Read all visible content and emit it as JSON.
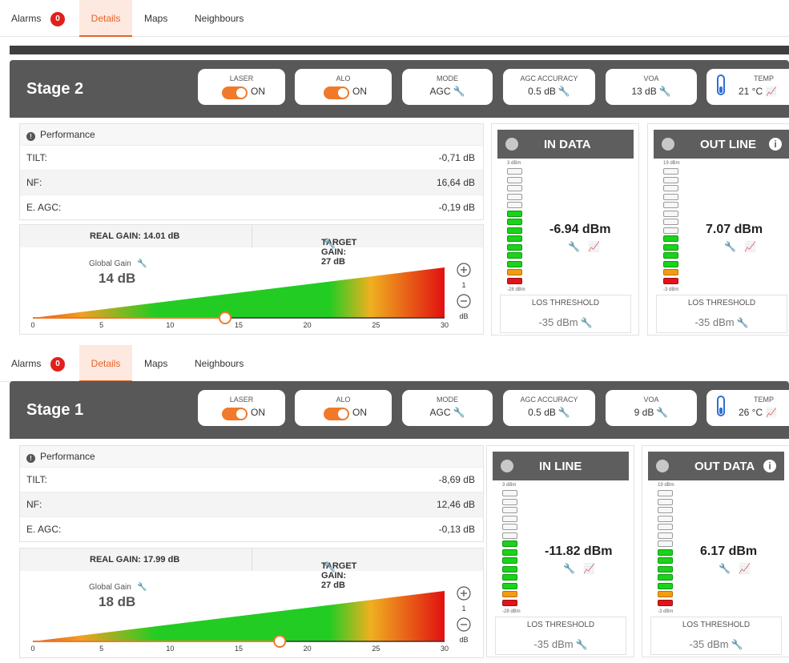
{
  "panels": [
    {
      "tabs": {
        "alarms": "Alarms",
        "alarm_count": "0",
        "details": "Details",
        "maps": "Maps",
        "neighbours": "Neighbours"
      },
      "title": "Stage 2",
      "laser": {
        "label": "LASER",
        "value": "ON"
      },
      "alo": {
        "label": "ALO",
        "value": "ON"
      },
      "mode": {
        "label": "MODE",
        "value": "AGC"
      },
      "agc_accuracy": {
        "label": "AGC ACCURACY",
        "value": "0.5 dB"
      },
      "voa": {
        "label": "VOA",
        "value": "13 dB"
      },
      "temp": {
        "label": "TEMP",
        "value": "21 °C"
      },
      "performance": {
        "title": "Performance",
        "rows": [
          {
            "label": "TILT:",
            "value": "-0,71 dB"
          },
          {
            "label": "NF:",
            "value": "16,64 dB"
          },
          {
            "label": "E. AGC:",
            "value": "-0,19 dB"
          }
        ]
      },
      "gain": {
        "real": "REAL GAIN: 14.01 dB",
        "target": "TARGET GAIN: 27 dB",
        "global_label": "Global Gain",
        "global_value": "14 dB",
        "slider_value": 14.01,
        "scale_max": 30,
        "ticks": [
          "0",
          "5",
          "10",
          "15",
          "20",
          "25",
          "30"
        ],
        "step": "1",
        "unit": "dB"
      },
      "meters": [
        {
          "title": "IN DATA",
          "top_tick": "3 dBm",
          "bottom_tick": "-28 dBm",
          "reading": "-6.94 dBm",
          "los_label": "LOS THRESHOLD",
          "los_value": "-35 dBm",
          "has_info": false,
          "segments": [
            "e",
            "e",
            "e",
            "e",
            "e",
            "g",
            "g",
            "g",
            "g",
            "g",
            "g",
            "g",
            "o",
            "r"
          ]
        },
        {
          "title": "OUT LINE",
          "top_tick": "19 dBm",
          "bottom_tick": "-3 dBm",
          "reading": "7.07 dBm",
          "los_label": "LOS THRESHOLD",
          "los_value": "-35 dBm",
          "has_info": true,
          "segments": [
            "e",
            "e",
            "e",
            "e",
            "e",
            "e",
            "e",
            "e",
            "g",
            "g",
            "g",
            "g",
            "o",
            "r"
          ]
        }
      ]
    },
    {
      "tabs": {
        "alarms": "Alarms",
        "alarm_count": "0",
        "details": "Details",
        "maps": "Maps",
        "neighbours": "Neighbours"
      },
      "title": "Stage 1",
      "laser": {
        "label": "LASER",
        "value": "ON"
      },
      "alo": {
        "label": "ALO",
        "value": "ON"
      },
      "mode": {
        "label": "MODE",
        "value": "AGC"
      },
      "agc_accuracy": {
        "label": "AGC ACCURACY",
        "value": "0.5 dB"
      },
      "voa": {
        "label": "VOA",
        "value": "9 dB"
      },
      "temp": {
        "label": "TEMP",
        "value": "26 °C"
      },
      "performance": {
        "title": "Performance",
        "rows": [
          {
            "label": "TILT:",
            "value": "-8,69 dB"
          },
          {
            "label": "NF:",
            "value": "12,46 dB"
          },
          {
            "label": "E. AGC:",
            "value": "-0,13 dB"
          }
        ]
      },
      "gain": {
        "real": "REAL GAIN: 17.99 dB",
        "target": "TARGET GAIN: 27 dB",
        "global_label": "Global Gain",
        "global_value": "18 dB",
        "slider_value": 17.99,
        "scale_max": 30,
        "ticks": [
          "0",
          "5",
          "10",
          "15",
          "20",
          "25",
          "30"
        ],
        "step": "1",
        "unit": "dB"
      },
      "meters": [
        {
          "title": "IN LINE",
          "top_tick": "3 dBm",
          "bottom_tick": "-28 dBm",
          "reading": "-11.82 dBm",
          "los_label": "LOS THRESHOLD",
          "los_value": "-35 dBm",
          "has_info": false,
          "segments": [
            "e",
            "e",
            "e",
            "e",
            "e",
            "e",
            "g",
            "g",
            "g",
            "g",
            "g",
            "g",
            "o",
            "r"
          ]
        },
        {
          "title": "OUT DATA",
          "top_tick": "19 dBm",
          "bottom_tick": "-3 dBm",
          "reading": "6.17 dBm",
          "los_label": "LOS THRESHOLD",
          "los_value": "-35 dBm",
          "has_info": true,
          "segments": [
            "e",
            "e",
            "e",
            "e",
            "e",
            "e",
            "e",
            "g",
            "g",
            "g",
            "g",
            "g",
            "o",
            "r"
          ]
        }
      ]
    }
  ]
}
